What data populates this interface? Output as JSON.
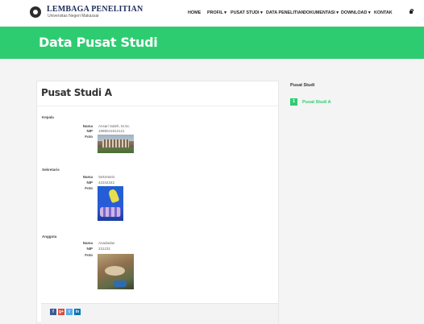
{
  "header": {
    "logo_title": "LEMBAGA PENELITIAN",
    "logo_subtitle": "Universitas Negeri Makassar",
    "nav": [
      {
        "label": "HOME"
      },
      {
        "label": "PROFIL ▾"
      },
      {
        "label": "PUSAT STUDI ▾"
      },
      {
        "label": "DATA PENELITIAN"
      },
      {
        "label": "DOKUMENTASI ▾"
      },
      {
        "label": "DOWNLOAD ▾"
      },
      {
        "label": "KONTAK"
      }
    ],
    "lock_icon": "lock-icon"
  },
  "banner": {
    "title": "Data Pusat Studi",
    "color": "#2ecc71"
  },
  "main": {
    "title": "Pusat Studi A",
    "sections": [
      {
        "label": "Kepala",
        "nama_key": "Nama",
        "nama": "Ansari Saleh, M.Sc.",
        "nip_key": "NIP",
        "nip": "1988041812121",
        "foto_key": "Foto"
      },
      {
        "label": "Sekretaris",
        "nama_key": "Nama",
        "nama": "Sekretaris",
        "nip_key": "NIP",
        "nip": "42342342",
        "foto_key": "Foto"
      },
      {
        "label": "Anggota",
        "nama_key": "Nama",
        "nama": "Anadadas",
        "nip_key": "NIP",
        "nip": "231231",
        "foto_key": "Foto"
      }
    ],
    "share": [
      {
        "label": "f",
        "icon": "facebook-icon",
        "color": "#3b5998"
      },
      {
        "label": "g+",
        "icon": "google-plus-icon",
        "color": "#dd4b39"
      },
      {
        "label": "t",
        "icon": "twitter-icon",
        "color": "#55acee"
      },
      {
        "label": "in",
        "icon": "linkedin-icon",
        "color": "#0077b5"
      }
    ]
  },
  "sidebar": {
    "title": "Pusat Studi",
    "items": [
      {
        "num": "1",
        "label": "Pusat Studi A"
      }
    ]
  }
}
